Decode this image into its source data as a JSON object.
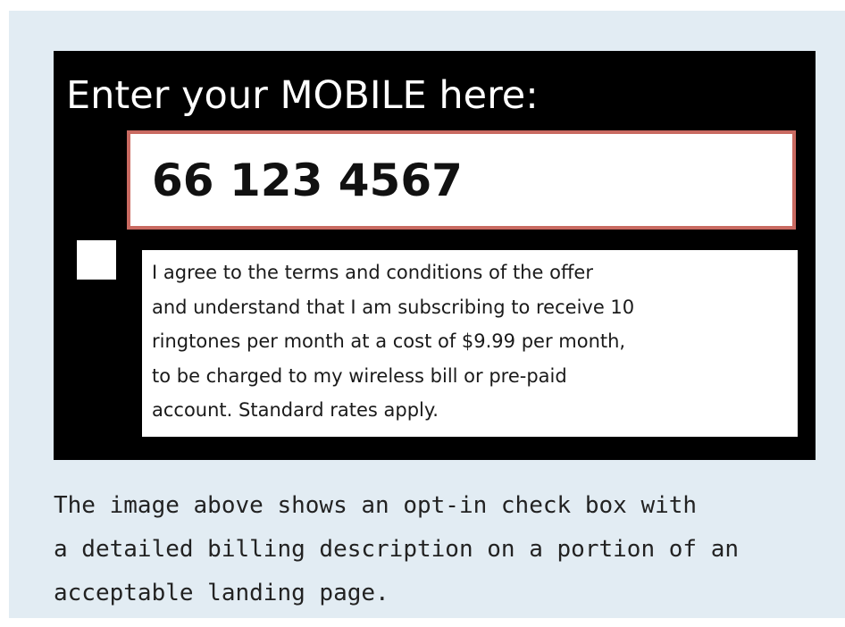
{
  "landing_page": {
    "heading": "Enter your MOBILE here:",
    "mobile_number": "66 123 4567",
    "opt_in_checked": false,
    "terms_lines": [
      "I agree to the terms and conditions of the offer",
      "and understand that I am subscribing to receive 10",
      "ringtones per month at a cost of $9.99 per month,",
      "to be charged to my wireless bill or pre-paid",
      "account. Standard rates apply."
    ]
  },
  "caption_lines": [
    "The image above shows an opt-in check box with",
    "a detailed billing description on a portion of an",
    "acceptable landing page."
  ],
  "colors": {
    "panel_background": "#e2ecf3",
    "screenshot_background": "#000000",
    "input_border": "#c96a61"
  }
}
